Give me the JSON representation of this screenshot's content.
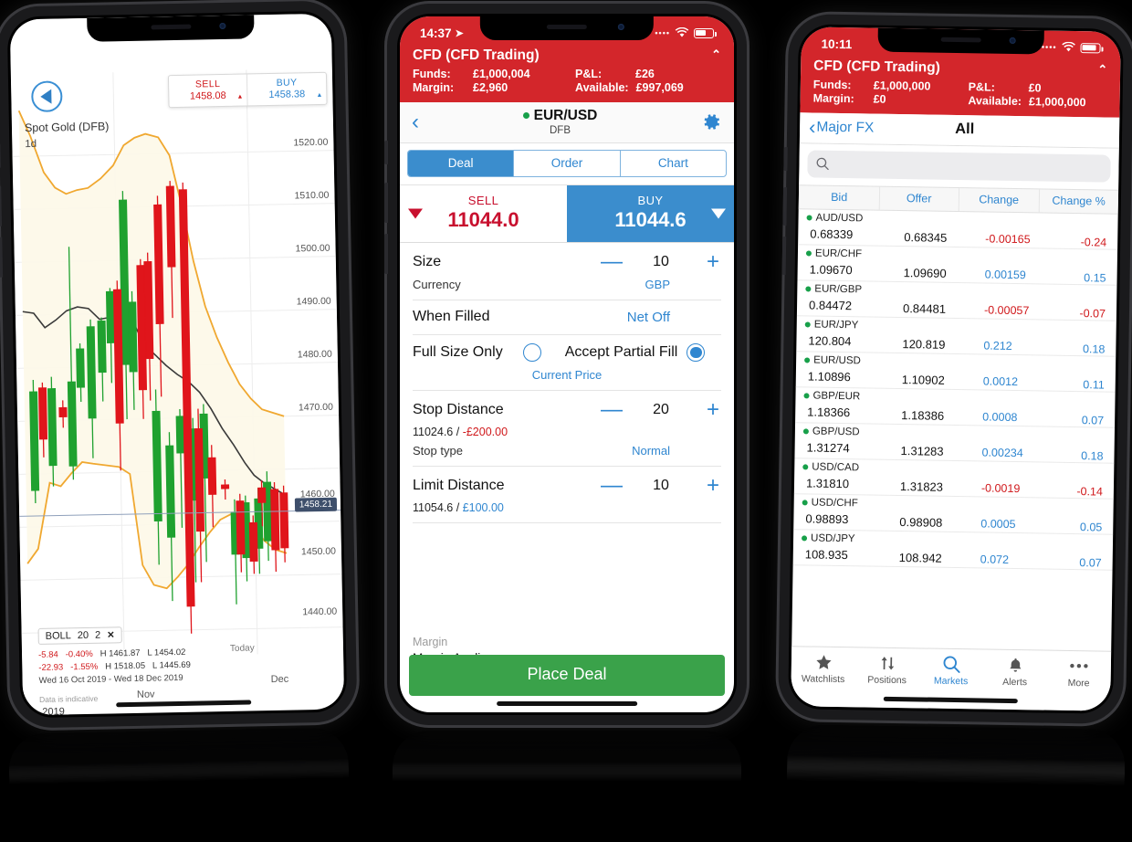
{
  "phone1": {
    "name": "chart-phone",
    "sell": {
      "label": "SELL",
      "value": "1458.08",
      "arrow": "▲"
    },
    "buy": {
      "label": "BUY",
      "value": "1458.38",
      "arrow": "▲"
    },
    "instrument": "Spot Gold (DFB)",
    "resolution": "1d",
    "price_marker": "1458.21",
    "indicator_chip": {
      "name": "BOLL",
      "p1": "20",
      "p2": "2",
      "close": "✕"
    },
    "legend": {
      "row1": {
        "chg": "-5.84",
        "pct": "-0.40%",
        "high": "H 1461.87",
        "low": "L 1454.02",
        "period": "Today"
      },
      "row2": {
        "chg": "-22.93",
        "pct": "-1.55%",
        "high": "H 1518.05",
        "low": "L 1445.69"
      },
      "range": "Wed 16 Oct 2019 - Wed 18 Dec 2019"
    },
    "disclaimer": "Data is indicative",
    "year": "2019",
    "chart_data": {
      "type": "line",
      "title": "Spot Gold (DFB)",
      "ylabel": "",
      "xlabel": "",
      "ylim": [
        1436,
        1524
      ],
      "yticks": [
        "1520.00",
        "1510.00",
        "1500.00",
        "1490.00",
        "1480.00",
        "1470.00",
        "1460.00",
        "1450.00",
        "1440.00"
      ],
      "xticks": [
        "Nov",
        "Dec"
      ],
      "grid": true,
      "series": [
        {
          "name": "Bollinger Upper",
          "color": "#f0a830"
        },
        {
          "name": "Bollinger Lower",
          "color": "#f0a830"
        },
        {
          "name": "Moving Average",
          "color": "#333333"
        },
        {
          "name": "Candles",
          "up_color": "#1fa12f",
          "down_color": "#e0151b"
        }
      ]
    }
  },
  "phone2": {
    "name": "deal-ticket-phone",
    "status": {
      "time": "14:37",
      "location_icon": "➤"
    },
    "account": {
      "title": "CFD (CFD Trading)",
      "collapse_icon": "chevron-up",
      "funds_label": "Funds:",
      "funds_value": "£1,000,004",
      "pl_label": "P&L:",
      "pl_value": "£26",
      "margin_label": "Margin:",
      "margin_value": "£2,960",
      "available_label": "Available:",
      "available_value": "£997,069"
    },
    "instrument": {
      "name": "EUR/USD",
      "sub": "DFB",
      "status_dot": "live"
    },
    "tabs": [
      {
        "label": "Deal",
        "active": true
      },
      {
        "label": "Order",
        "active": false
      },
      {
        "label": "Chart",
        "active": false
      }
    ],
    "sell": {
      "label": "SELL",
      "price": "11044.0"
    },
    "buy": {
      "label": "BUY",
      "price": "11044.6"
    },
    "size": {
      "label": "Size",
      "value": "10",
      "minus": "—",
      "plus": "+"
    },
    "currency": {
      "label": "Currency",
      "value": "GBP"
    },
    "when_filled": {
      "label": "When Filled",
      "value": "Net Off"
    },
    "fill": {
      "full_label": "Full Size Only",
      "partial_label": "Accept Partial Fill",
      "selected": "partial",
      "note": "Current Price"
    },
    "stop": {
      "label": "Stop Distance",
      "value": "20",
      "minus": "—",
      "plus": "+",
      "level": "11024.6 / ",
      "amount": "-£200.00",
      "type_label": "Stop type",
      "type_value": "Normal"
    },
    "limit": {
      "label": "Limit Distance",
      "value": "10",
      "minus": "—",
      "plus": "+",
      "level": "11054.6 / ",
      "amount": "£100.00"
    },
    "margin": {
      "label": "Margin",
      "value": "Margin Applies"
    },
    "place_button": "Place Deal"
  },
  "phone3": {
    "name": "markets-phone",
    "status": {
      "time": "10:11"
    },
    "account": {
      "title": "CFD (CFD Trading)",
      "collapse_icon": "chevron-up",
      "funds_label": "Funds:",
      "funds_value": "£1,000,000",
      "pl_label": "P&L:",
      "pl_value": "£0",
      "margin_label": "Margin:",
      "margin_value": "£0",
      "available_label": "Available:",
      "available_value": "£1,000,000"
    },
    "nav": {
      "back": "Major FX",
      "title": "All"
    },
    "search": {
      "placeholder": "",
      "icon": "search-icon"
    },
    "columns": [
      "Bid",
      "Offer",
      "Change",
      "Change %"
    ],
    "rows": [
      {
        "name": "AUD/USD",
        "bid": "0.68339",
        "offer": "0.68345",
        "change": "-0.00165",
        "pct": "-0.24",
        "dir": "down"
      },
      {
        "name": "EUR/CHF",
        "bid": "1.09670",
        "offer": "1.09690",
        "change": "0.00159",
        "pct": "0.15",
        "dir": "up"
      },
      {
        "name": "EUR/GBP",
        "bid": "0.84472",
        "offer": "0.84481",
        "change": "-0.00057",
        "pct": "-0.07",
        "dir": "down"
      },
      {
        "name": "EUR/JPY",
        "bid": "120.804",
        "offer": "120.819",
        "change": "0.212",
        "pct": "0.18",
        "dir": "up"
      },
      {
        "name": "EUR/USD",
        "bid": "1.10896",
        "offer": "1.10902",
        "change": "0.0012",
        "pct": "0.11",
        "dir": "up"
      },
      {
        "name": "GBP/EUR",
        "bid": "1.18366",
        "offer": "1.18386",
        "change": "0.0008",
        "pct": "0.07",
        "dir": "up"
      },
      {
        "name": "GBP/USD",
        "bid": "1.31274",
        "offer": "1.31283",
        "change": "0.00234",
        "pct": "0.18",
        "dir": "up"
      },
      {
        "name": "USD/CAD",
        "bid": "1.31810",
        "offer": "1.31823",
        "change": "-0.0019",
        "pct": "-0.14",
        "dir": "down"
      },
      {
        "name": "USD/CHF",
        "bid": "0.98893",
        "offer": "0.98908",
        "change": "0.0005",
        "pct": "0.05",
        "dir": "up"
      },
      {
        "name": "USD/JPY",
        "bid": "108.935",
        "offer": "108.942",
        "change": "0.072",
        "pct": "0.07",
        "dir": "up"
      }
    ],
    "tabbar": [
      {
        "label": "Watchlists",
        "icon": "star-icon",
        "active": false
      },
      {
        "label": "Positions",
        "icon": "arrows-icon",
        "active": false
      },
      {
        "label": "Markets",
        "icon": "search-icon",
        "active": true
      },
      {
        "label": "Alerts",
        "icon": "bell-icon",
        "active": false
      },
      {
        "label": "More",
        "icon": "ellipsis-icon",
        "active": false
      }
    ]
  },
  "colors": {
    "brand_red": "#D3262B",
    "accent_blue": "#2F86D0",
    "buy_blue": "#3B8DCD",
    "sell_red": "#C8102E",
    "place_green": "#3AA24A",
    "live_green": "#18A04A",
    "boll_orange": "#F0A830",
    "candle_up": "#1FA12F",
    "candle_down": "#E0151B"
  }
}
